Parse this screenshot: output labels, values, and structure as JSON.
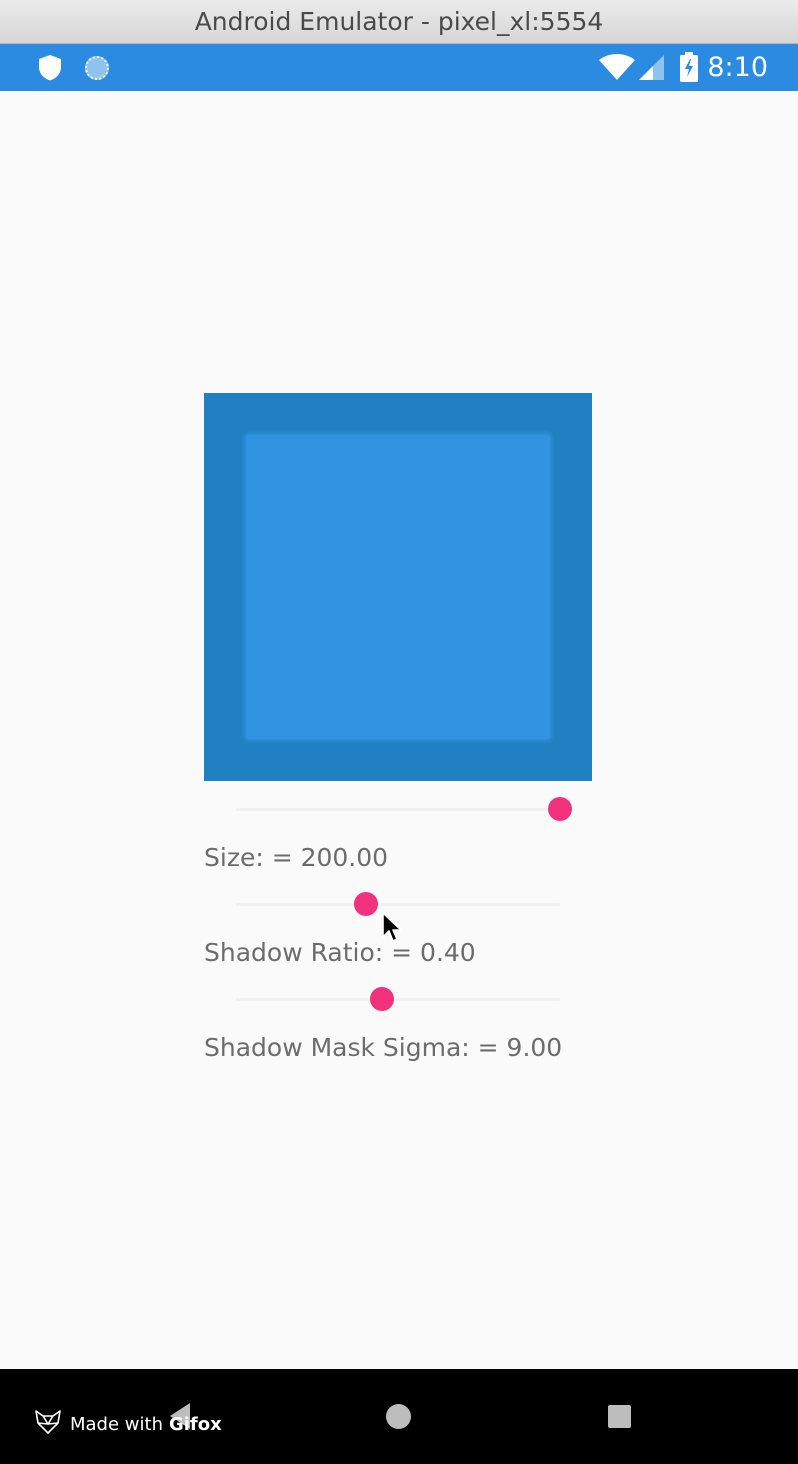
{
  "window": {
    "title": "Android Emulator - pixel_xl:5554"
  },
  "status_bar": {
    "time": "8:10",
    "background_color": "#2a8be0",
    "left_icons": [
      "shield-icon",
      "sync-icon"
    ],
    "right_icons": [
      "wifi-icon",
      "cell-signal-icon",
      "battery-charging-icon"
    ]
  },
  "preview": {
    "outer_color": "#2180c2",
    "inner_color": "#3194e0"
  },
  "controls": {
    "accent_color": "#f2317c",
    "size": {
      "label": "Size: = 200.00",
      "slider_fraction": 1.0
    },
    "shadow_ratio": {
      "label": "Shadow Ratio: = 0.40",
      "slider_fraction": 0.4
    },
    "shadow_mask_sigma": {
      "label": "Shadow Mask Sigma: = 9.00",
      "slider_fraction": 0.45
    }
  },
  "nav_bar": {
    "buttons": [
      "back-icon",
      "home-icon",
      "recents-icon"
    ]
  },
  "watermark": {
    "made_with": "Made with",
    "brand": "Gifox"
  }
}
